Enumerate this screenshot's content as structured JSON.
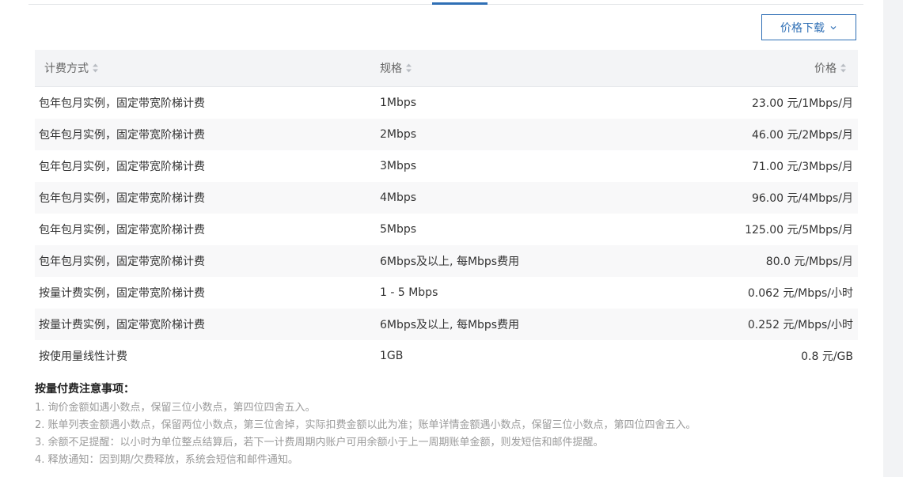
{
  "toolbar": {
    "download_label": "价格下载"
  },
  "table": {
    "headers": {
      "billing_method": "计费方式",
      "spec": "规格",
      "price": "价格"
    },
    "rows": [
      {
        "billing_method": "包年包月实例，固定带宽阶梯计费",
        "spec": "1Mbps",
        "price": "23.00 元/1Mbps/月"
      },
      {
        "billing_method": "包年包月实例，固定带宽阶梯计费",
        "spec": "2Mbps",
        "price": "46.00 元/2Mbps/月"
      },
      {
        "billing_method": "包年包月实例，固定带宽阶梯计费",
        "spec": "3Mbps",
        "price": "71.00 元/3Mbps/月"
      },
      {
        "billing_method": "包年包月实例，固定带宽阶梯计费",
        "spec": "4Mbps",
        "price": "96.00 元/4Mbps/月"
      },
      {
        "billing_method": "包年包月实例，固定带宽阶梯计费",
        "spec": "5Mbps",
        "price": "125.00 元/5Mbps/月"
      },
      {
        "billing_method": "包年包月实例，固定带宽阶梯计费",
        "spec": "6Mbps及以上, 每Mbps费用",
        "price": "80.0 元/Mbps/月"
      },
      {
        "billing_method": "按量计费实例，固定带宽阶梯计费",
        "spec": "1 - 5 Mbps",
        "price": "0.062 元/Mbps/小时"
      },
      {
        "billing_method": "按量计费实例，固定带宽阶梯计费",
        "spec": "6Mbps及以上, 每Mbps费用",
        "price": "0.252 元/Mbps/小时"
      },
      {
        "billing_method": "按使用量线性计费",
        "spec": "1GB",
        "price": "0.8 元/GB"
      }
    ]
  },
  "notes": {
    "title": "按量付费注意事项：",
    "items": [
      "1. 询价金额如遇小数点，保留三位小数点，第四位四舍五入。",
      "2. 账单列表金额遇小数点，保留两位小数点，第三位舍掉，实际扣费金额以此为准；账单详情金额遇小数点，保留三位小数点，第四位四舍五入。",
      "3. 余额不足提醒：以小时为单位整点结算后，若下一计费周期内账户可用余额小于上一周期账单金额，则发短信和邮件提醒。",
      "4. 释放通知：因到期/欠费释放，系统会短信和邮件通知。"
    ]
  },
  "colors": {
    "accent": "#2f6fb5",
    "header_bg": "#f3f4f6",
    "alt_row_bg": "#f8f8f9",
    "note_text": "#9a9a9a"
  }
}
